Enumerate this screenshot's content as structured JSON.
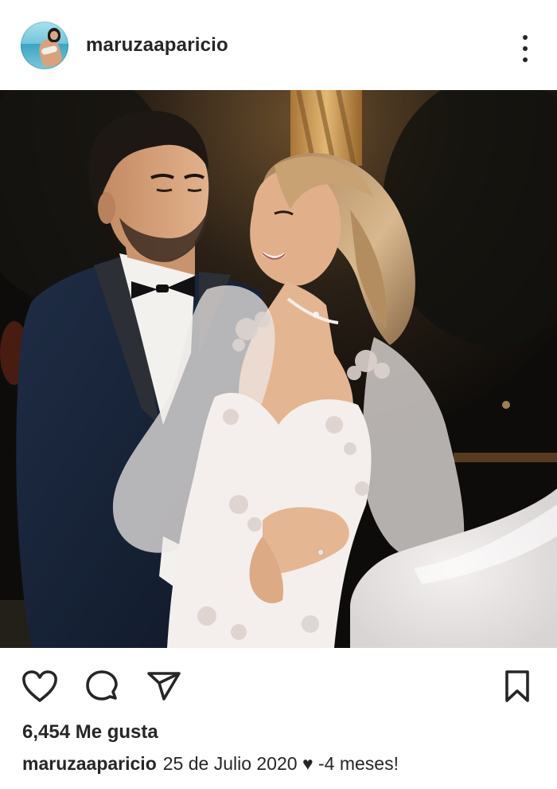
{
  "post": {
    "username": "maruzaaparicio",
    "likes_text": "6,454 Me gusta",
    "caption": {
      "username": "maruzaaparicio",
      "text": "25 de Julio 2020 ♥ -4 meses!"
    }
  },
  "icons": {
    "more": "more-vertical-icon",
    "like": "heart-icon",
    "comment": "comment-bubble-icon",
    "share": "paper-plane-icon",
    "save": "bookmark-icon"
  },
  "colors": {
    "text": "#262626",
    "background": "#ffffff"
  }
}
